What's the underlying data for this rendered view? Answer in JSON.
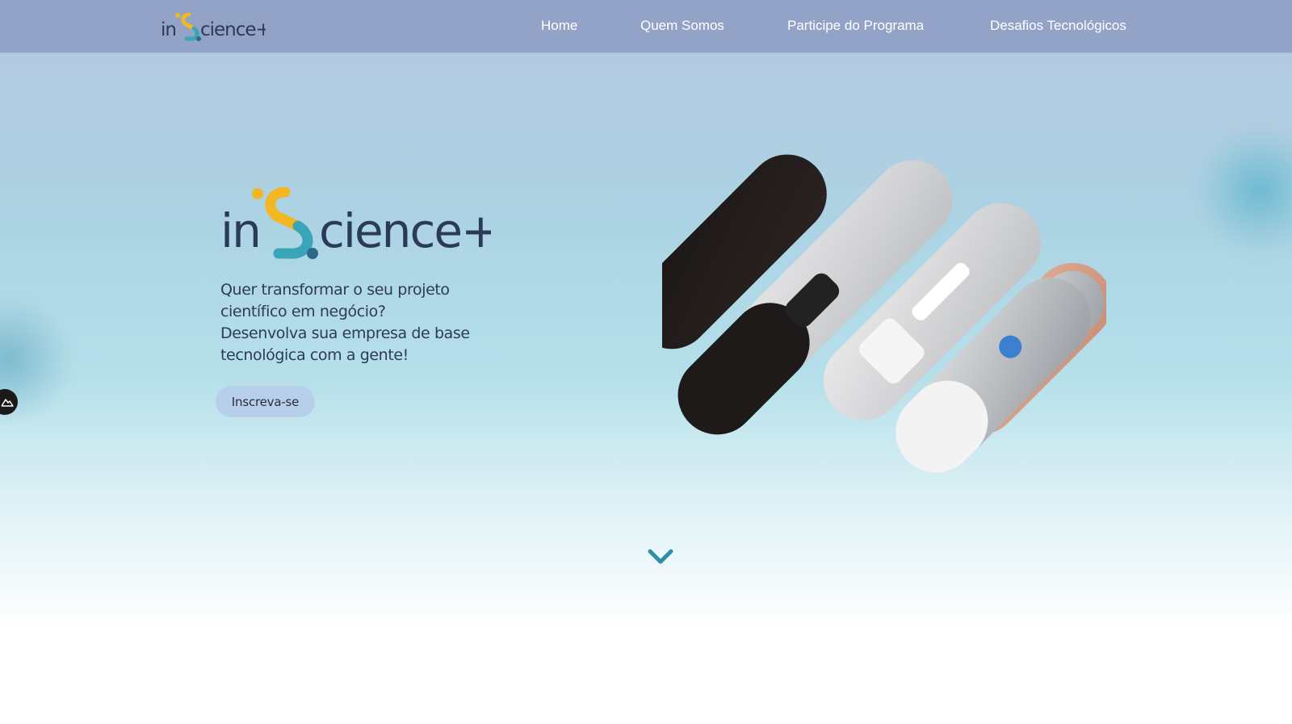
{
  "brand": {
    "logo_text": "inScience+",
    "colors": {
      "yellow": "#f2b824",
      "teal": "#3aa5b8",
      "navy": "#2b3a57",
      "nav_bg": "#93a3c8"
    }
  },
  "nav": {
    "items": [
      {
        "label": "Home"
      },
      {
        "label": "Quem Somos"
      },
      {
        "label": "Participe do Programa"
      },
      {
        "label": "Desafios Tecnológicos"
      }
    ]
  },
  "hero": {
    "headline_lines": [
      "Quer transformar o seu projeto",
      "científico em negócio?",
      "Desenvolva sua empresa de base",
      "tecnológica com a gente!"
    ],
    "cta_label": "Inscreva-se"
  },
  "icons": {
    "side_widget": "mountain-icon",
    "scroll": "chevron-down-icon"
  }
}
